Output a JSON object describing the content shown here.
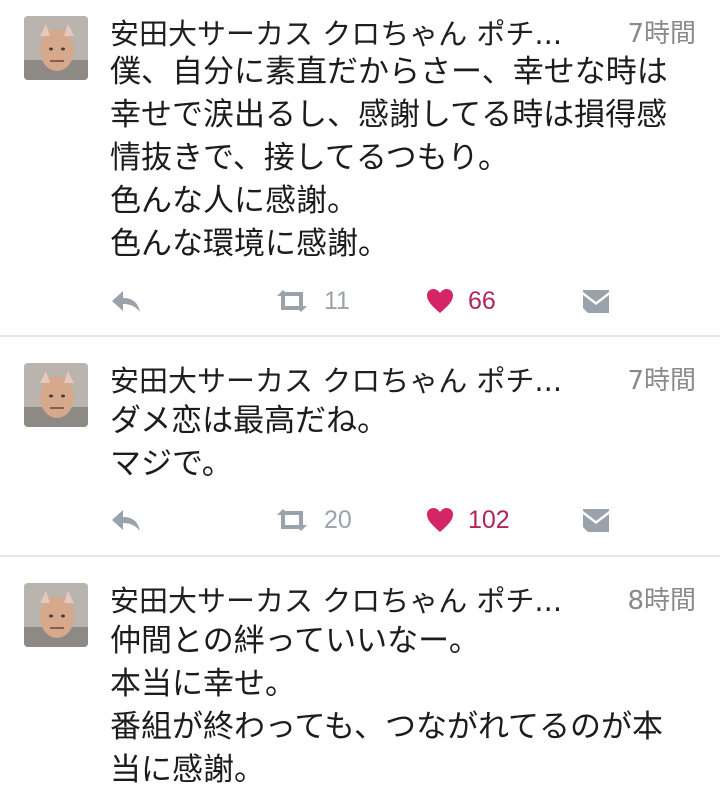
{
  "tweets": [
    {
      "name": "安田大サーカス クロちゃん ポチ...",
      "time": "7時間",
      "lines": [
        "僕、自分に素直だからさー、幸せな時は",
        "幸せで涙出るし、感謝してる時は損得感",
        "情抜きで、接してるつもり。",
        "色んな人に感謝。",
        "色んな環境に感謝。"
      ],
      "retweets": "11",
      "likes": "66"
    },
    {
      "name": "安田大サーカス クロちゃん ポチ...",
      "time": "7時間",
      "lines": [
        "ダメ恋は最高だね。",
        "マジで。"
      ],
      "retweets": "20",
      "likes": "102"
    },
    {
      "name": "安田大サーカス クロちゃん ポチ...",
      "time": "8時間",
      "lines": [
        "仲間との絆っていいなー。",
        "本当に幸せ。",
        "番組が終わっても、つながれてるのが本",
        "当に感謝。"
      ]
    }
  ],
  "colors": {
    "text": "#1c1c1c",
    "muted": "#8a8a8a",
    "icon": "#9aa3ab",
    "like": "#d42566",
    "divider": "#e6e6e6"
  },
  "icons": [
    "reply-icon",
    "retweet-icon",
    "heart-icon",
    "direct-message-icon"
  ]
}
